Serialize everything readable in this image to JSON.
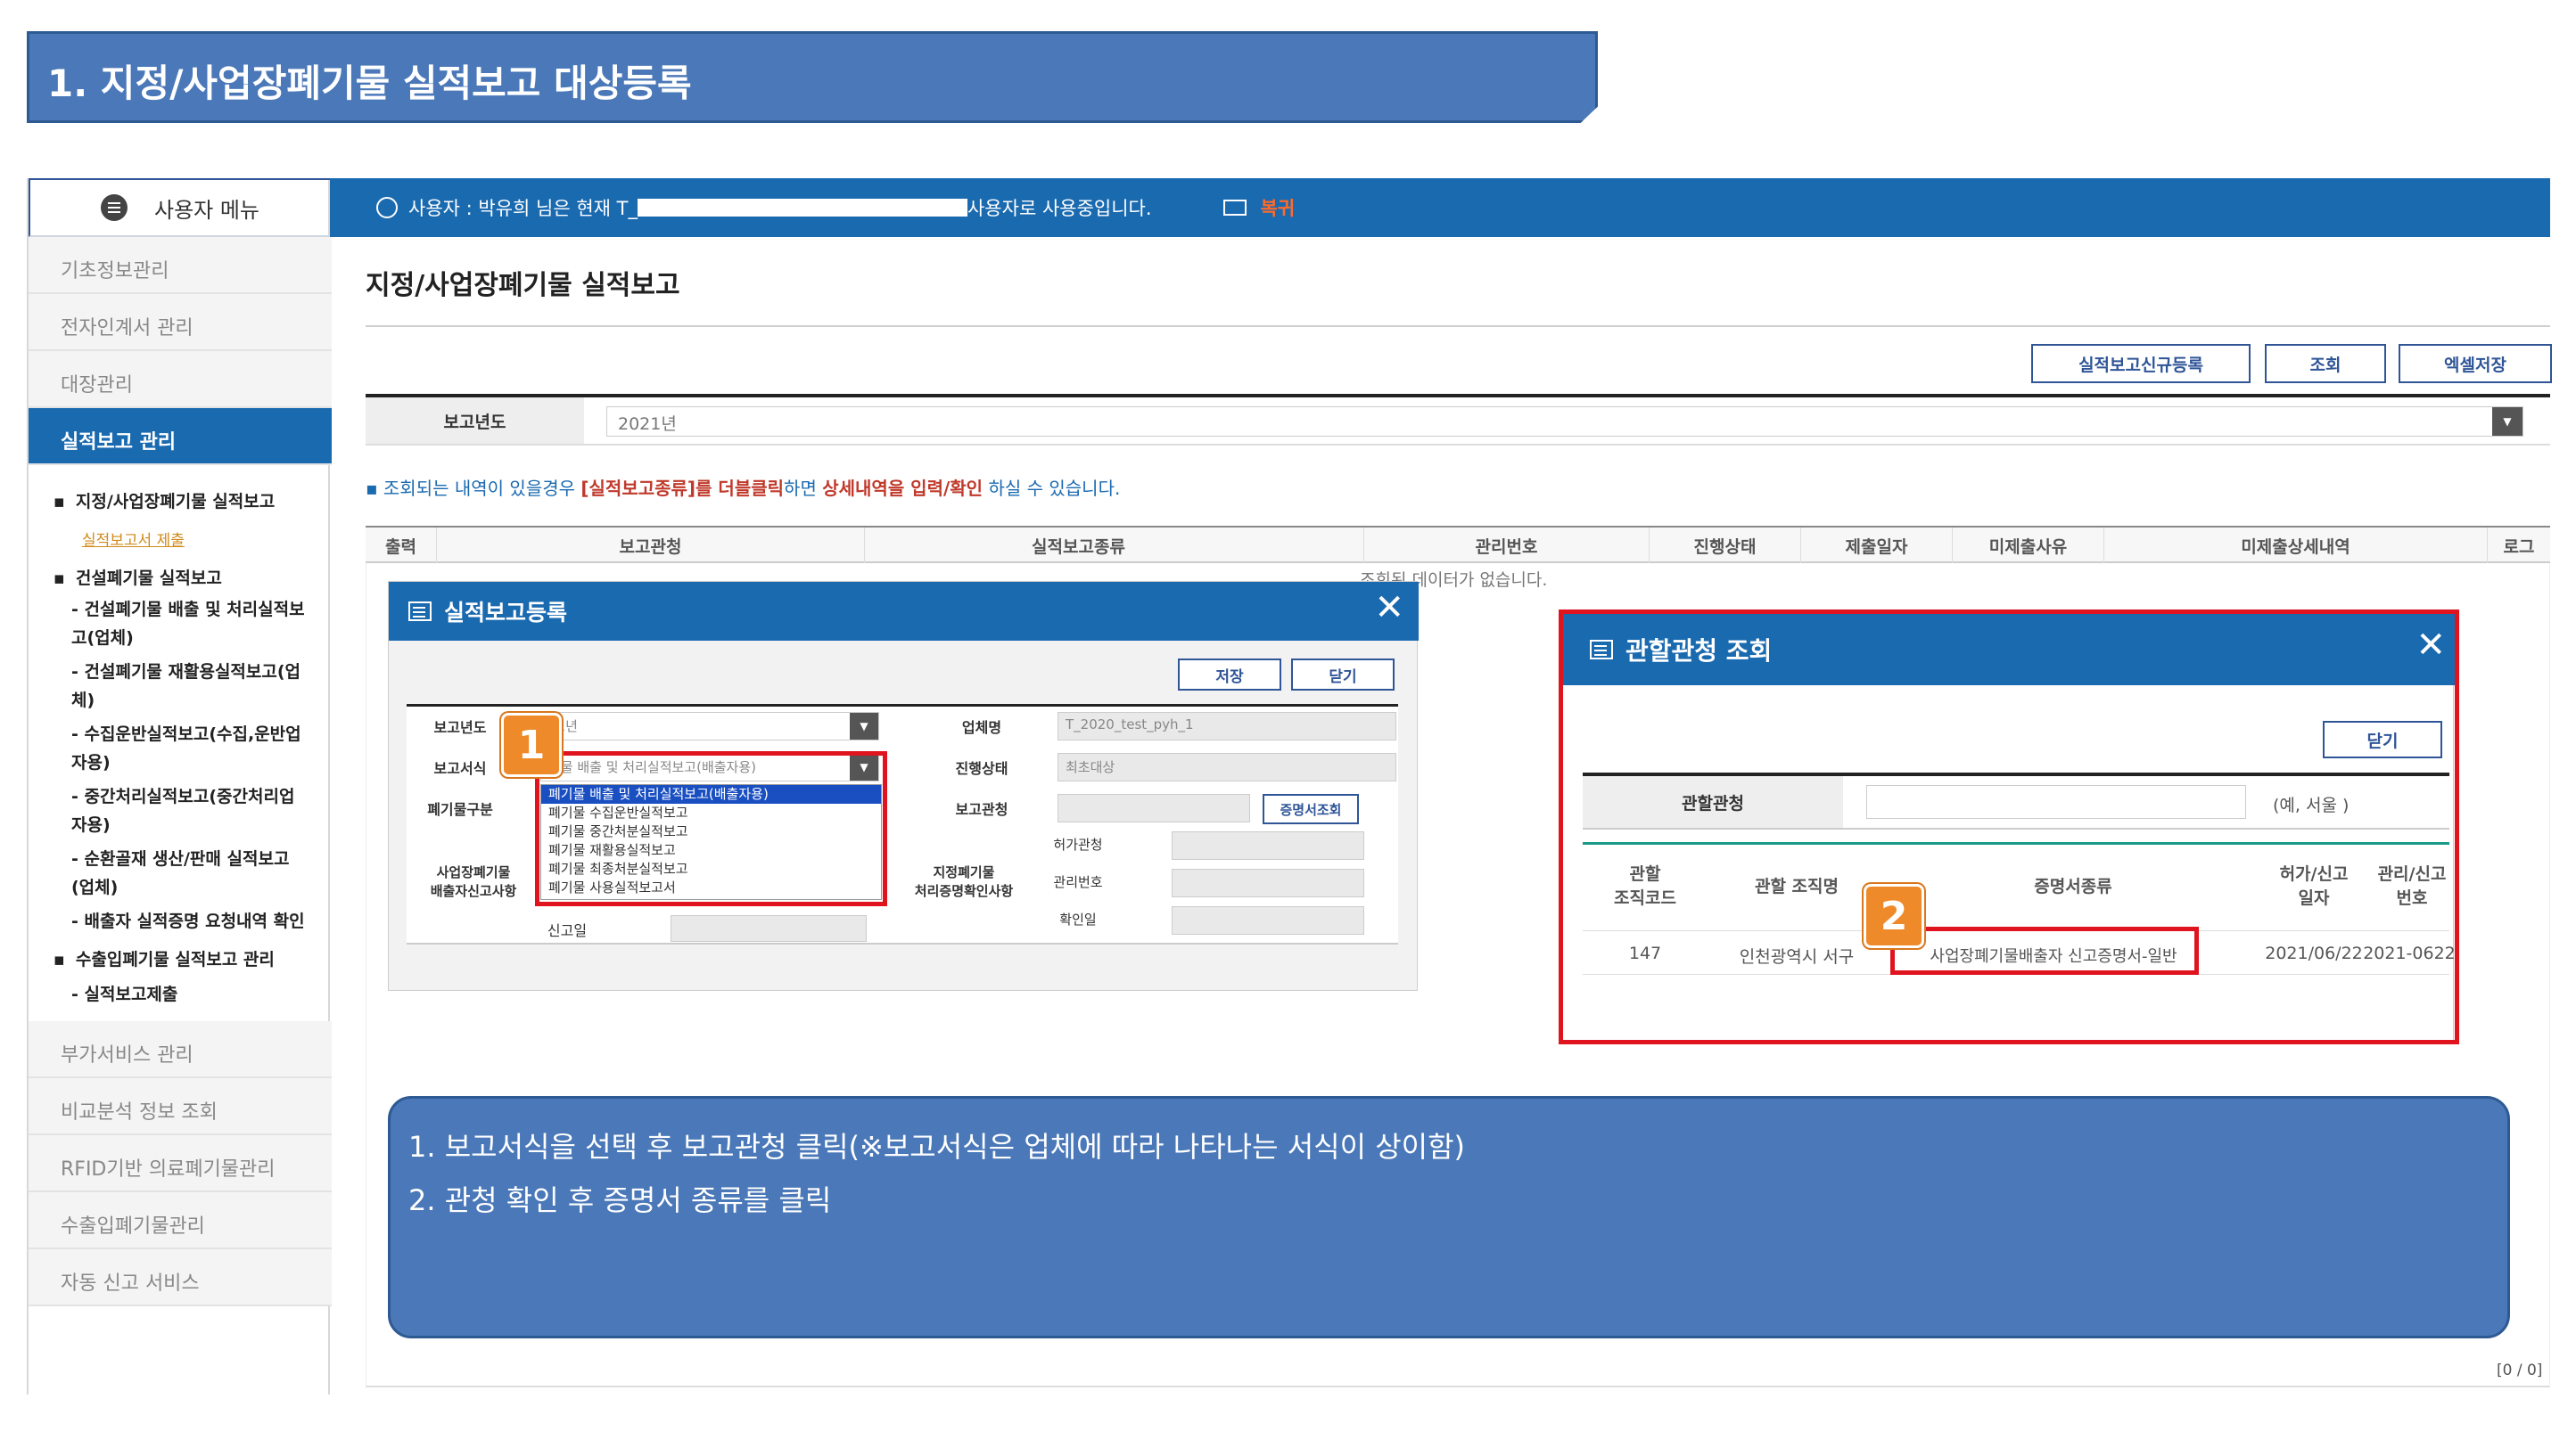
{
  "banner": {
    "title": "1. 지정/사업장폐기물 실적보고 대상등록"
  },
  "sidebar": {
    "header": "사용자 메뉴",
    "items_top": [
      "기초정보관리",
      "전자인계서 관리",
      "대장관리"
    ],
    "active": "실적보고 관리",
    "sub": {
      "s1": "지정/사업장폐기물 실적보고",
      "s1_link": "실적보고서 제출",
      "s2": "건설폐기물 실적보고",
      "s2a": "- 건설폐기물 배출 및 처리실적보",
      "s2a2": "고(업체)",
      "s2b": "- 건설폐기물 재활용실적보고(업",
      "s2b2": "체)",
      "s2c": "- 수집운반실적보고(수집,운반업",
      "s2c2": "자용)",
      "s2d": "- 중간처리실적보고(중간처리업",
      "s2d2": "자용)",
      "s2e": "- 순환골재 생산/판매 실적보고",
      "s2e2": "(업체)",
      "s2f": "- 배출자 실적증명 요청내역 확인",
      "s3": "수출입폐기물 실적보고 관리",
      "s3a": "- 실적보고제출"
    },
    "items_bottom": [
      "부가서비스 관리",
      "비교분석 정보 조회",
      "RFID기반 의료폐기물관리",
      "수출입폐기물관리",
      "자동 신고 서비스"
    ]
  },
  "topbar": {
    "user_prefix": "사용자 : 박유희 님은 현재 T_",
    "user_suffix": "사용자로 사용중입니다.",
    "back": "복귀"
  },
  "page": {
    "title": "지정/사업장폐기물 실적보고",
    "buttons": {
      "new": "실적보고신규등록",
      "search": "조회",
      "excel": "엑셀저장"
    },
    "filter": {
      "label": "보고년도",
      "value": "2021년"
    },
    "notice_pre": "▪ 조회되는 내역이 있을경우 ",
    "notice_hl": "[실적보고종류]를 더블클릭",
    "notice_mid": "하면 ",
    "notice_hl2": "상세내역을 입력/확인",
    "notice_post": " 하실 수 있습니다.",
    "columns": [
      "출력",
      "보고관청",
      "실적보고종류",
      "관리번호",
      "진행상태",
      "제출일자",
      "미제출사유",
      "미제출상세내역",
      "로그"
    ],
    "nodata": "조회된 데이터가 없습니다.",
    "pager": "[0 / 0]"
  },
  "dialog1": {
    "title": "실적보고등록",
    "save": "저장",
    "close": "닫기",
    "labels": {
      "year": "보고년도",
      "form": "보고서식",
      "waste_type": "폐기물구분",
      "biz_reg": "사업장폐기물\n배출자신고사항",
      "report_date": "신고일",
      "company": "업체명",
      "status": "진행상태",
      "office": "보고관청",
      "designated": "지정폐기물\n처리증명확인사항",
      "permit_office": "허가관청",
      "mgmt_no": "관리번호",
      "confirm_date": "확인일"
    },
    "values": {
      "year": "21년",
      "form": "기물 배출 및 처리실적보고(배출자용)",
      "company": "T_2020_test_pyh_1",
      "status": "최초대상"
    },
    "cert_button": "증명서조회",
    "options": [
      "폐기물 배출 및 처리실적보고(배출자용)",
      "폐기물 수집운반실적보고",
      "폐기물 중간처분실적보고",
      "폐기물 재활용실적보고",
      "폐기물 최종처분실적보고",
      "폐기물 사용실적보고서"
    ]
  },
  "dialog2": {
    "title": "관할관청 조회",
    "close": "닫기",
    "search_label": "관할관청",
    "search_hint": "(예, 서울 )",
    "columns": [
      "관할\n조직코드",
      "관할 조직명",
      "증명서종류",
      "허가/신고\n일자",
      "관리/신고\n번호"
    ],
    "row": {
      "code": "147",
      "org": "인천광역시 서구",
      "cert": "사업장폐기물배출자 신고증명서-일반",
      "date": "2021/06/22",
      "no": "2021-0622"
    }
  },
  "badges": [
    "1",
    "2"
  ],
  "callout": {
    "line1": "1. 보고서식을 선택 후 보고관청 클릭(※보고서식은 업체에 따라 나타나는 서식이 상이함)",
    "line2": "2. 관청 확인 후 증명서 종류를 클릭"
  }
}
